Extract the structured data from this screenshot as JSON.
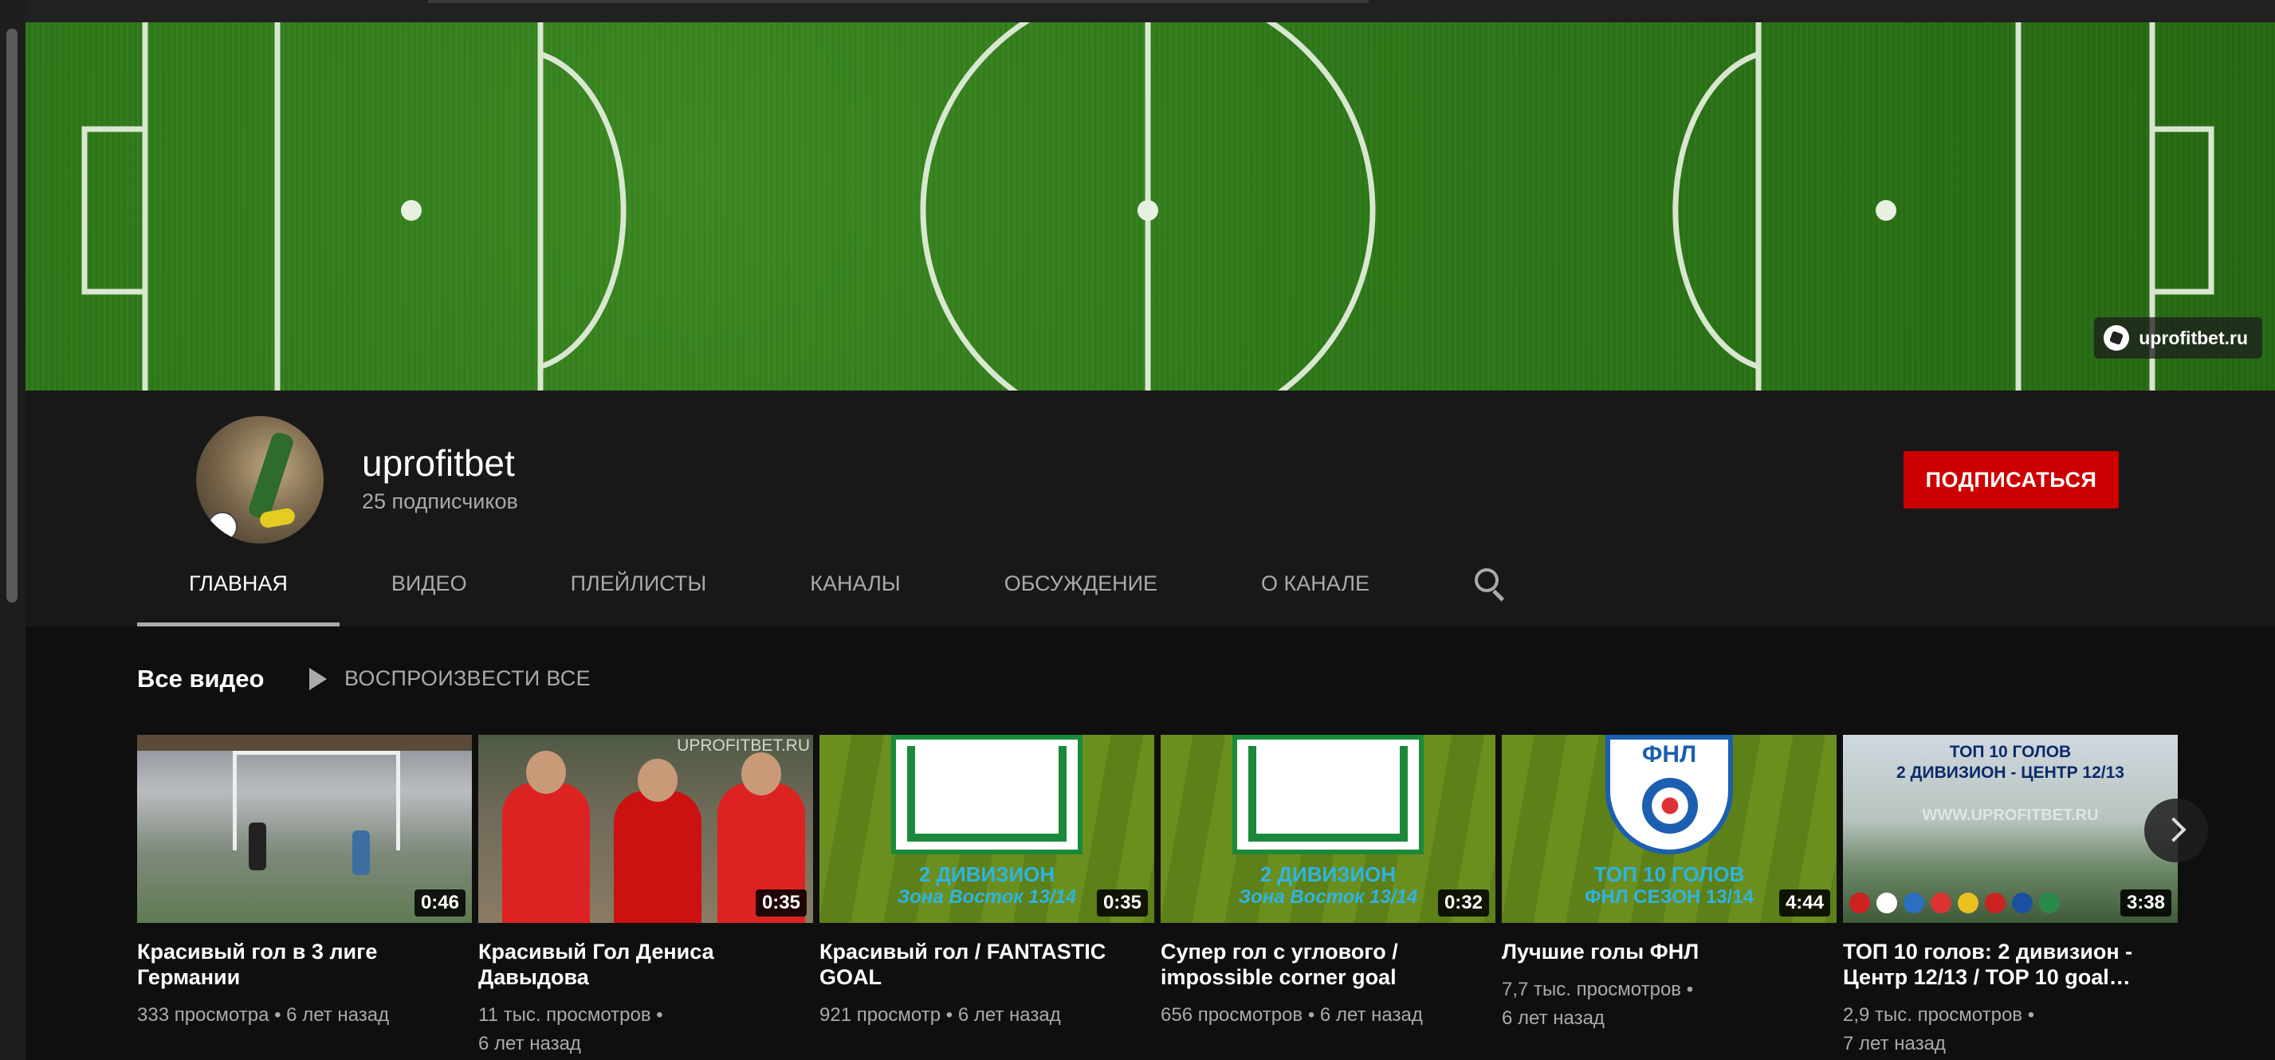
{
  "banner": {
    "watermark": "uprofitbet.ru"
  },
  "channel": {
    "name": "uprofitbet",
    "subscribers": "25 подписчиков",
    "subscribe_label": "ПОДПИСАТЬСЯ"
  },
  "tabs": [
    {
      "label": "ГЛАВНАЯ",
      "active": true
    },
    {
      "label": "ВИДЕО"
    },
    {
      "label": "ПЛЕЙЛИСТЫ"
    },
    {
      "label": "КАНАЛЫ"
    },
    {
      "label": "ОБСУЖДЕНИЕ"
    },
    {
      "label": "О КАНАЛЕ"
    }
  ],
  "section": {
    "title": "Все видео",
    "play_all": "ВОСПРОИЗВЕСТИ ВСЕ"
  },
  "videos": [
    {
      "title": "Красивый гол в 3 лиге Германии",
      "duration": "0:46",
      "views": "333 просмотра",
      "age": "6 лет назад"
    },
    {
      "title": "Красивый Гол Дениса Давыдова",
      "duration": "0:35",
      "views": "11 тыс. просмотров",
      "age": "6 лет назад",
      "thumb_text": "UPROFITBET.RU"
    },
    {
      "title": "Красивый гол / FANTASTIC GOAL",
      "duration": "0:35",
      "views": "921 просмотр",
      "age": "6 лет назад",
      "thumb_text": "2 ДИВИЗИОН",
      "thumb_sub": "Зона Восток 13/14"
    },
    {
      "title": "Супер гол с углового / impossible corner goal",
      "duration": "0:32",
      "views": "656 просмотров",
      "age": "6 лет назад",
      "thumb_text": "2 ДИВИЗИОН",
      "thumb_sub": "Зона Восток 13/14"
    },
    {
      "title": "Лучшие голы ФНЛ",
      "duration": "4:44",
      "views": "7,7 тыс. просмотров",
      "age": "6 лет назад",
      "thumb_logo": "ФНЛ",
      "thumb_text": "ТОП 10 ГОЛОВ",
      "thumb_sub": "ФНЛ СЕЗОН 13/14"
    },
    {
      "title": "ТОП 10 голов: 2 дивизион - Центр 12/13 / TOP 10 goal…",
      "duration": "3:38",
      "views": "2,9 тыс. просмотров",
      "age": "7 лет назад",
      "thumb_text": "ТОП 10 ГОЛОВ",
      "thumb_sub": "2 ДИВИЗИОН - ЦЕНТР 12/13",
      "thumb_url": "WWW.UPROFITBET.RU"
    }
  ],
  "colors": {
    "accent": "#cc0000",
    "background": "#0f0f0f",
    "header": "#181818",
    "grass": "#2f7a1a"
  }
}
